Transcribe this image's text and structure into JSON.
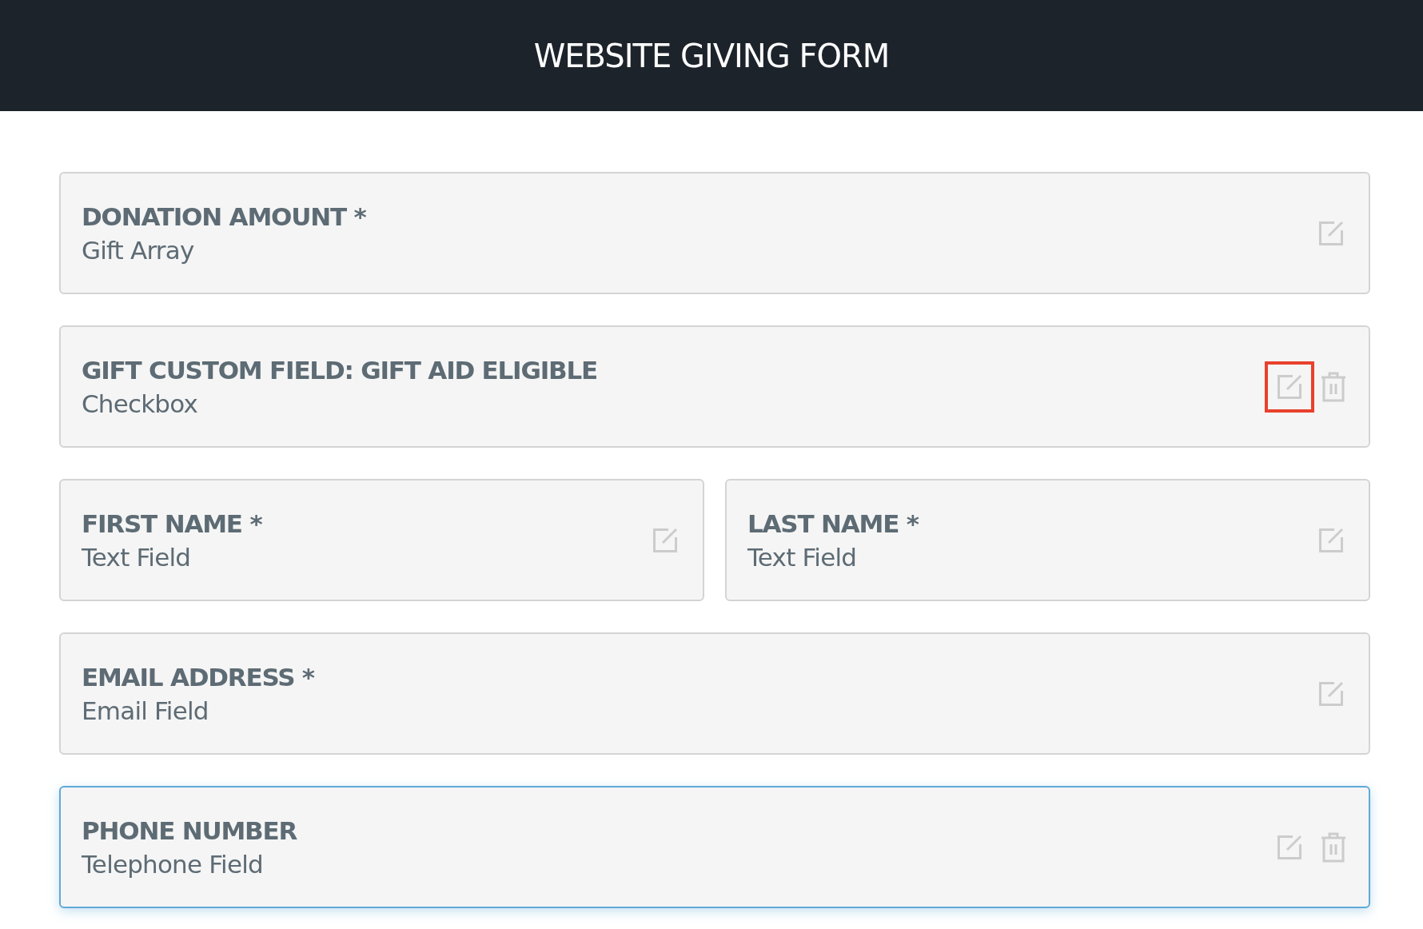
{
  "header": {
    "title": "WEBSITE GIVING FORM"
  },
  "rows": [
    {
      "fields": [
        {
          "label": "DONATION AMOUNT *",
          "type": "Gift Array",
          "deletable": false,
          "selected": false,
          "edit_highlighted": false
        }
      ]
    },
    {
      "fields": [
        {
          "label": "GIFT CUSTOM FIELD: GIFT AID ELIGIBLE",
          "type": "Checkbox",
          "deletable": true,
          "selected": false,
          "edit_highlighted": true
        }
      ]
    },
    {
      "fields": [
        {
          "label": "FIRST NAME *",
          "type": "Text Field",
          "deletable": false,
          "selected": false,
          "edit_highlighted": false
        },
        {
          "label": "LAST NAME *",
          "type": "Text Field",
          "deletable": false,
          "selected": false,
          "edit_highlighted": false
        }
      ]
    },
    {
      "fields": [
        {
          "label": "EMAIL ADDRESS *",
          "type": "Email Field",
          "deletable": false,
          "selected": false,
          "edit_highlighted": false
        }
      ]
    },
    {
      "fields": [
        {
          "label": "PHONE NUMBER",
          "type": "Telephone Field",
          "deletable": true,
          "selected": true,
          "edit_highlighted": false
        }
      ]
    }
  ]
}
